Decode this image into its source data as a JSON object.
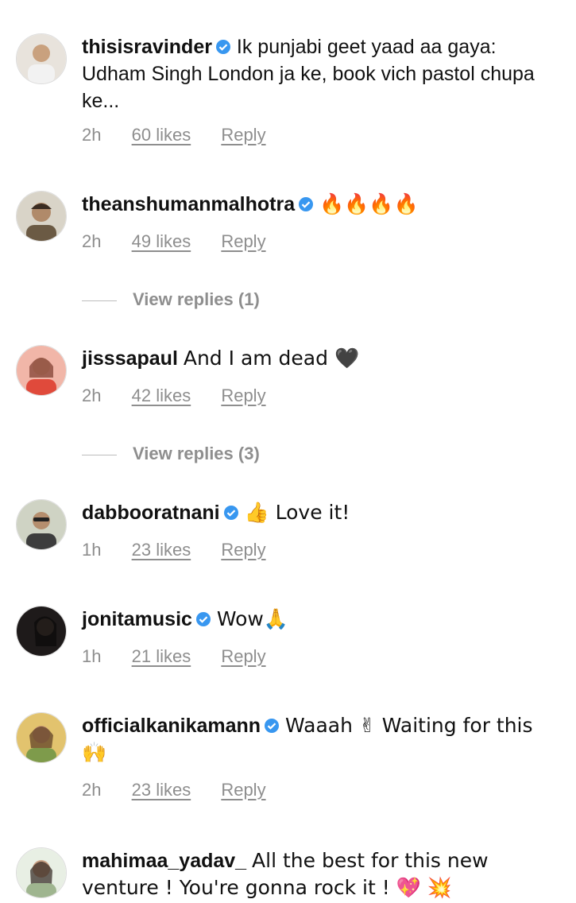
{
  "comments": [
    {
      "username": "thisisravinder",
      "verified": true,
      "text": "Ik punjabi geet yaad aa gaya: Udham Singh London ja ke, book vich pastol chupa ke...",
      "time": "2h",
      "likes": "60 likes",
      "reply": "Reply",
      "avatar_color": "#c9bfb3"
    },
    {
      "username": "theanshumanmalhotra",
      "verified": true,
      "text": "🔥🔥🔥🔥",
      "time": "2h",
      "likes": "49 likes",
      "reply": "Reply",
      "view_replies": "View replies (1)",
      "avatar_color": "#8a7a60"
    },
    {
      "username": "jisssapaul",
      "verified": false,
      "text": "And I am dead 🖤",
      "time": "2h",
      "likes": "42 likes",
      "reply": "Reply",
      "view_replies": "View replies (3)",
      "avatar_color": "#d2736a"
    },
    {
      "username": "dabbooratnani",
      "verified": true,
      "text": "👍 Love it!",
      "time": "1h",
      "likes": "23 likes",
      "reply": "Reply",
      "avatar_color": "#6f7f64"
    },
    {
      "username": "jonitamusic",
      "verified": true,
      "text": "Wow🙏",
      "time": "1h",
      "likes": "21 likes",
      "reply": "Reply",
      "avatar_color": "#2b2424"
    },
    {
      "username": "officialkanikamann",
      "verified": true,
      "text": "Waaah ✌ Waiting for this 🙌",
      "time": "2h",
      "likes": "23 likes",
      "reply": "Reply",
      "avatar_color": "#c9a24a"
    },
    {
      "username": "mahimaa_yadav_",
      "verified": false,
      "text": "All the best for this new venture ! You're gonna rock it ! 💖 💥",
      "avatar_color": "#b9c9b0"
    }
  ],
  "colors": {
    "verified": "#3897f0",
    "meta": "#8e8e8e"
  }
}
